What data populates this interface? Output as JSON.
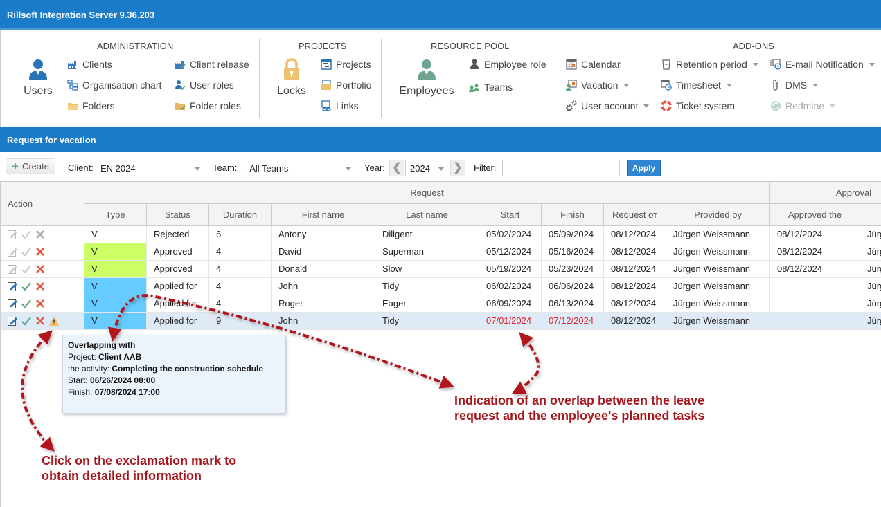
{
  "app": {
    "title": "Rillsoft Integration Server 9.36.203"
  },
  "ribbon": {
    "administration": {
      "title": "ADMINISTRATION",
      "big_button": "Users",
      "items": [
        "Clients",
        "Organisation chart",
        "Folders",
        "Client release",
        "User roles",
        "Folder roles"
      ]
    },
    "projects": {
      "title": "PROJECTS",
      "big_button": "Locks",
      "items": [
        "Projects",
        "Portfolio",
        "Links"
      ]
    },
    "resource_pool": {
      "title": "RESOURCE POOL",
      "big_button": "Employees",
      "items": [
        "Employee role",
        "Teams"
      ]
    },
    "addons": {
      "title": "ADD-ONS",
      "items": [
        {
          "label": "Calendar",
          "dropdown": false
        },
        {
          "label": "Vacation",
          "dropdown": true
        },
        {
          "label": "User account",
          "dropdown": true
        },
        {
          "label": "Retention period",
          "dropdown": true
        },
        {
          "label": "Timesheet",
          "dropdown": true
        },
        {
          "label": "Ticket system",
          "dropdown": false
        },
        {
          "label": "E-mail Notification",
          "dropdown": true
        },
        {
          "label": "DMS",
          "dropdown": true
        },
        {
          "label": "Redmine",
          "dropdown": true,
          "disabled": true
        }
      ]
    }
  },
  "panel": {
    "title": "Request for vacation"
  },
  "toolbar": {
    "create_label": "Create",
    "client_label": "Client:",
    "client_value": "EN 2024",
    "team_label": "Team:",
    "team_value": "- All Teams -",
    "year_label": "Year:",
    "year_value": "2024",
    "filter_label": "Filter:",
    "filter_value": "",
    "apply_label": "Apply"
  },
  "grid": {
    "group_headers": {
      "action": "Action",
      "request": "Request",
      "approval": "Approval"
    },
    "columns": [
      "Type",
      "Status",
      "Duration",
      "First name",
      "Last name",
      "Start",
      "Finish",
      "Request от",
      "Provided by",
      "Approved the",
      ""
    ],
    "rows": [
      {
        "actions_enabled": false,
        "reject_active": false,
        "warning": false,
        "type": "V",
        "type_color": "",
        "status": "Rejected",
        "duration": "6",
        "first": "Antony",
        "last": "Diligent",
        "start": "05/02/2024",
        "finish": "05/09/2024",
        "request": "08/12/2024",
        "provided_by": "Jürgen Weissmann",
        "approved": "08/12/2024",
        "approver": "Jürg",
        "overlap": false
      },
      {
        "actions_enabled": false,
        "reject_active": true,
        "warning": false,
        "type": "V",
        "type_color": "#ccff66",
        "status": "Approved",
        "duration": "4",
        "first": "David",
        "last": "Superman",
        "start": "05/12/2024",
        "finish": "05/16/2024",
        "request": "08/12/2024",
        "provided_by": "Jürgen Weissmann",
        "approved": "08/12/2024",
        "approver": "Jürg",
        "overlap": false
      },
      {
        "actions_enabled": false,
        "reject_active": true,
        "warning": false,
        "type": "V",
        "type_color": "#ccff66",
        "status": "Approved",
        "duration": "4",
        "first": "Donald",
        "last": "Slow",
        "start": "05/19/2024",
        "finish": "05/23/2024",
        "request": "08/12/2024",
        "provided_by": "Jürgen Weissmann",
        "approved": "08/12/2024",
        "approver": "Jürg",
        "overlap": false
      },
      {
        "actions_enabled": true,
        "reject_active": true,
        "warning": false,
        "type": "V",
        "type_color": "#66ccff",
        "status": "Applied for",
        "duration": "4",
        "first": "John",
        "last": "Tidy",
        "start": "06/02/2024",
        "finish": "06/06/2024",
        "request": "08/12/2024",
        "provided_by": "Jürgen Weissmann",
        "approved": "",
        "approver": "Jürg",
        "overlap": false
      },
      {
        "actions_enabled": true,
        "reject_active": true,
        "warning": false,
        "type": "V",
        "type_color": "#66ccff",
        "status": "Applied for",
        "duration": "4",
        "first": "Roger",
        "last": "Eager",
        "start": "06/09/2024",
        "finish": "06/13/2024",
        "request": "08/12/2024",
        "provided_by": "Jürgen Weissmann",
        "approved": "",
        "approver": "Jürg",
        "overlap": false
      },
      {
        "actions_enabled": true,
        "reject_active": true,
        "warning": true,
        "type": "V",
        "type_color": "#66ccff",
        "status": "Applied for",
        "duration": "9",
        "first": "John",
        "last": "Tidy",
        "start": "07/01/2024",
        "finish": "07/12/2024",
        "request": "08/12/2024",
        "provided_by": "Jürgen Weissmann",
        "approved": "",
        "approver": "Jürg",
        "overlap": true,
        "selected": true
      }
    ]
  },
  "tooltip": {
    "heading": "Overlapping with",
    "project_label": "Project:",
    "project_value": "Client AAB",
    "activity_label": "the activity:",
    "activity_value": "Completing the construction schedule",
    "start_label": "Start:",
    "start_value": "06/26/2024 08:00",
    "finish_label": "Finish:",
    "finish_value": "07/08/2024 17:00"
  },
  "annotations": {
    "overlap_line1": "Indication of an overlap between the leave",
    "overlap_line2": "request and the employee's planned tasks",
    "click_line1": "Click on the exclamation mark to",
    "click_line2": "obtain detailed information"
  },
  "colors": {
    "header_blue": "#1a7cc9",
    "approved_green": "#ccff66",
    "applied_blue": "#66ccff",
    "overlap_red": "#e0202a",
    "annotation_red": "#a8161d",
    "selected_row": "#deebf7"
  }
}
